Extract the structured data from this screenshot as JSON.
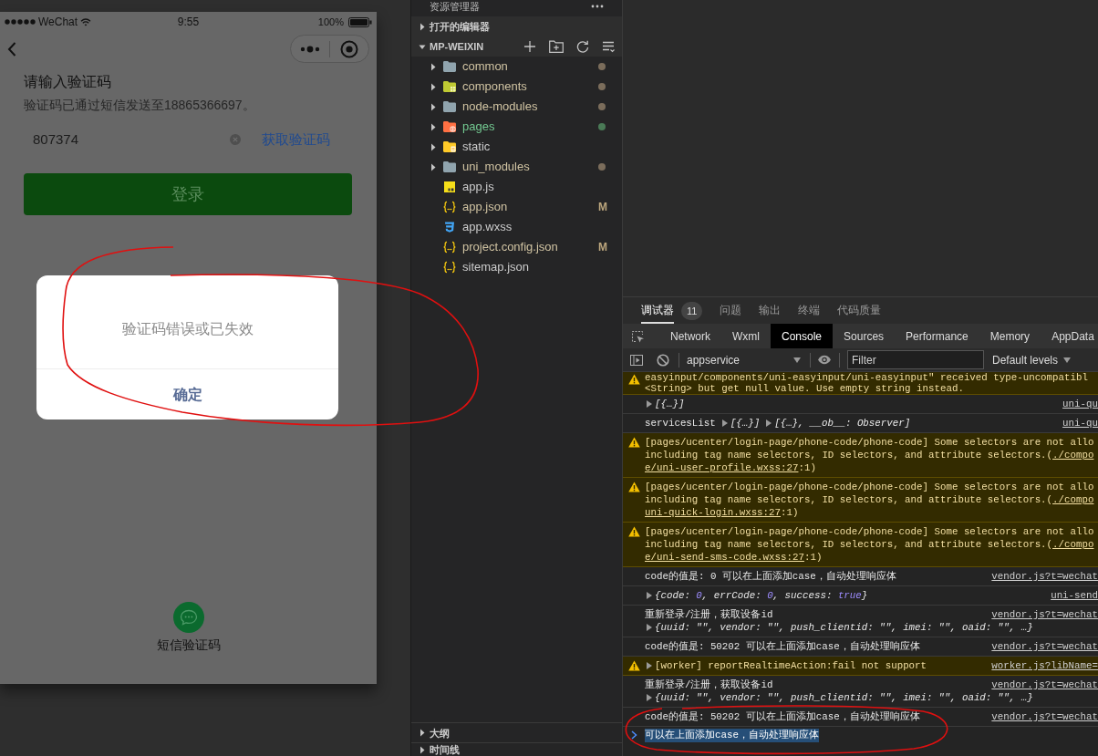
{
  "simulator": {
    "status_bar": {
      "carrier": "WeChat",
      "time": "9:55",
      "battery": "100%"
    },
    "heading": "请输入验证码",
    "subheading": "验证码已通过短信发送至18865366697。",
    "code_field": {
      "value": "807374"
    },
    "get_code": "获取验证码",
    "login_button": "登录",
    "dialog": {
      "message": "验证码错误或已失效",
      "buttons": [
        "确定"
      ]
    },
    "alt_login": {
      "label": "短信验证码"
    }
  },
  "explorer": {
    "title": "资源管理器",
    "sections": [
      {
        "label": "打开的编辑器",
        "expanded": false
      },
      {
        "label": "MP-WEIXIN",
        "expanded": true,
        "items": [
          {
            "name": "common",
            "kind": "folder",
            "expanded": false,
            "modified": true,
            "untracked": false
          },
          {
            "name": "components",
            "kind": "components-folder",
            "expanded": false,
            "modified": true,
            "untracked": false
          },
          {
            "name": "node-modules",
            "kind": "folder",
            "expanded": false,
            "modified": true,
            "untracked": false
          },
          {
            "name": "pages",
            "kind": "pages-folder",
            "expanded": false,
            "modified": false,
            "untracked": true
          },
          {
            "name": "static",
            "kind": "static-folder",
            "expanded": false,
            "modified": false,
            "untracked": false
          },
          {
            "name": "uni_modules",
            "kind": "folder",
            "expanded": false,
            "modified": true,
            "untracked": false
          },
          {
            "name": "app.js",
            "kind": "js",
            "modified": false,
            "untracked": false
          },
          {
            "name": "app.json",
            "kind": "json",
            "modified": true,
            "untracked": false,
            "badge": "M"
          },
          {
            "name": "app.wxss",
            "kind": "wxss",
            "modified": false,
            "untracked": false
          },
          {
            "name": "project.config.json",
            "kind": "json",
            "modified": true,
            "untracked": false,
            "badge": "M"
          },
          {
            "name": "sitemap.json",
            "kind": "json",
            "modified": false,
            "untracked": false
          }
        ]
      }
    ],
    "panels": [
      {
        "label": "大纲",
        "expanded": false
      },
      {
        "label": "时间线",
        "expanded": false
      }
    ]
  },
  "devtools": {
    "panel_tabs": [
      {
        "label": "调试器",
        "selected": true,
        "badge": "11"
      },
      {
        "label": "问题",
        "selected": false
      },
      {
        "label": "输出",
        "selected": false
      },
      {
        "label": "终端",
        "selected": false
      },
      {
        "label": "代码质量",
        "selected": false
      }
    ],
    "tool_tabs": [
      {
        "label": "Network",
        "selected": false
      },
      {
        "label": "Wxml",
        "selected": false
      },
      {
        "label": "Console",
        "selected": true
      },
      {
        "label": "Sources",
        "selected": false
      },
      {
        "label": "Performance",
        "selected": false
      },
      {
        "label": "Memory",
        "selected": false
      },
      {
        "label": "AppData",
        "selected": false
      }
    ],
    "toolbar": {
      "context": "appservice",
      "filter": {
        "placeholder": "Filter"
      },
      "levels": "Default levels"
    },
    "console": [
      {
        "kind": "warning",
        "lines": [
          [
            {
              "kind": "text",
              "text": "easyinput/components/uni-easyinput/uni-easyinput\" received type-uncompatibl"
            }
          ],
          [
            {
              "kind": "text",
              "text": "<String> but get null value. Use empty string instead."
            }
          ]
        ]
      },
      {
        "kind": "log",
        "lines": [
          [
            {
              "kind": "toggle",
              "expanded": false
            },
            {
              "kind": "object",
              "text": "[{…}]"
            }
          ]
        ],
        "source": "uni-qu"
      },
      {
        "kind": "log",
        "lines": [
          [
            {
              "kind": "text",
              "text": "servicesList"
            },
            {
              "kind": "toggle",
              "expanded": false
            },
            {
              "kind": "object",
              "text": "[{…}]"
            },
            {
              "kind": "toggle",
              "expanded": false
            },
            {
              "kind": "object",
              "text": "[{…}, __ob__: Observer]"
            }
          ]
        ],
        "source": "uni-qu"
      },
      {
        "kind": "warning",
        "lines": [
          [
            {
              "kind": "text",
              "text": "[pages/ucenter/login-page/phone-code/phone-code] Some selectors are not allo"
            }
          ],
          [
            {
              "kind": "text",
              "text": "including tag name selectors, ID selectors, and attribute selectors.("
            },
            {
              "kind": "link",
              "text": "./compo"
            }
          ],
          [
            {
              "kind": "link",
              "text": "e/uni-user-profile.wxss:27"
            },
            {
              "kind": "text",
              "text": ":1)"
            }
          ]
        ]
      },
      {
        "kind": "warning",
        "lines": [
          [
            {
              "kind": "text",
              "text": "[pages/ucenter/login-page/phone-code/phone-code] Some selectors are not allo"
            }
          ],
          [
            {
              "kind": "text",
              "text": "including tag name selectors, ID selectors, and attribute selectors.("
            },
            {
              "kind": "link",
              "text": "./compo"
            }
          ],
          [
            {
              "kind": "link",
              "text": "uni-quick-login.wxss:27"
            },
            {
              "kind": "text",
              "text": ":1)"
            }
          ]
        ]
      },
      {
        "kind": "warning",
        "lines": [
          [
            {
              "kind": "text",
              "text": "[pages/ucenter/login-page/phone-code/phone-code] Some selectors are not allo"
            }
          ],
          [
            {
              "kind": "text",
              "text": "including tag name selectors, ID selectors, and attribute selectors.("
            },
            {
              "kind": "link",
              "text": "./compo"
            }
          ],
          [
            {
              "kind": "link",
              "text": "e/uni-send-sms-code.wxss:27"
            },
            {
              "kind": "text",
              "text": ":1)"
            }
          ]
        ]
      },
      {
        "kind": "log",
        "lines": [
          [
            {
              "kind": "text",
              "text": "code的值是: 0 可以在上面添加case，自动处理响应体"
            }
          ]
        ],
        "source": "vendor.js?t=wechat"
      },
      {
        "kind": "log",
        "lines": [
          [
            {
              "kind": "toggle",
              "expanded": false
            },
            {
              "kind": "object",
              "text": "{code: "
            },
            {
              "kind": "value",
              "text": "0"
            },
            {
              "kind": "object",
              "text": ", errCode: "
            },
            {
              "kind": "value",
              "text": "0"
            },
            {
              "kind": "object",
              "text": ", success: "
            },
            {
              "kind": "value",
              "text": "true"
            },
            {
              "kind": "object",
              "text": "}"
            }
          ]
        ],
        "source": "uni-send"
      },
      {
        "kind": "log",
        "lines": [
          [
            {
              "kind": "text",
              "text": "重新登录/注册，获取设备id"
            }
          ],
          [
            {
              "kind": "toggle",
              "expanded": false
            },
            {
              "kind": "object",
              "text": "{uuid: \"\", vendor: \"\", push_clientid: \"\", imei: \"\", oaid: \"\", …}"
            }
          ]
        ],
        "source": "vendor.js?t=wechat"
      },
      {
        "kind": "log",
        "lines": [
          [
            {
              "kind": "text",
              "text": "code的值是: 50202 可以在上面添加case，自动处理响应体"
            }
          ]
        ],
        "source": "vendor.js?t=wechat"
      },
      {
        "kind": "warning",
        "lines": [
          [
            {
              "kind": "toggle",
              "expanded": false
            },
            {
              "kind": "text",
              "text": "[worker] reportRealtimeAction:fail not support"
            }
          ]
        ],
        "source": "worker.js?libName="
      },
      {
        "kind": "log",
        "lines": [
          [
            {
              "kind": "text",
              "text": "重新登录/注册，获取设备id"
            }
          ],
          [
            {
              "kind": "toggle",
              "expanded": false
            },
            {
              "kind": "object",
              "text": "{uuid: \"\", vendor: \"\", push_clientid: \"\", imei: \"\", oaid: \"\", …}"
            }
          ]
        ],
        "source": "vendor.js?t=wechat"
      },
      {
        "kind": "log",
        "lines": [
          [
            {
              "kind": "text",
              "text": "code的值是: 50202 可以在上面添加case，自动处理响应体"
            }
          ]
        ],
        "source": "vendor.js?t=wechat"
      }
    ],
    "prompt": {
      "value": "可以在上面添加case，自动处理响应体",
      "selected": true
    }
  }
}
